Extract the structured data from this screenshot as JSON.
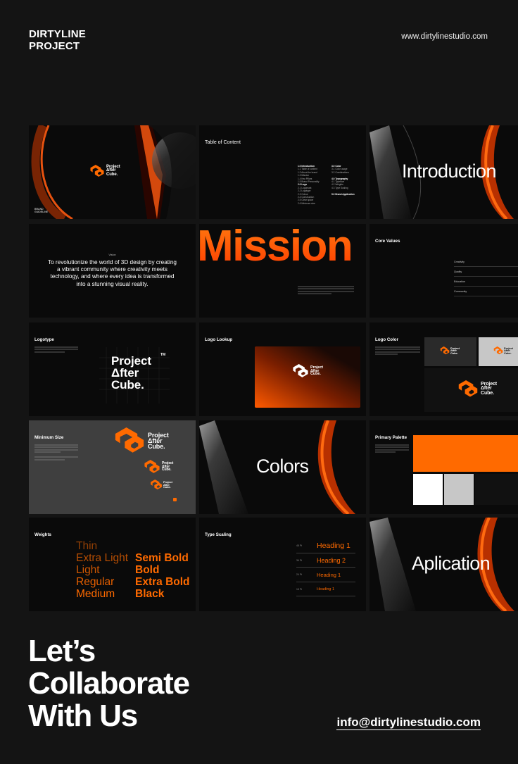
{
  "header": {
    "brand_line1": "DIRTYLINE",
    "brand_line2": "PROJECT",
    "website": "www.dirtylinestudio.com"
  },
  "logo": {
    "line1": "Project",
    "line2": "Δfter",
    "line3": "Cube.",
    "tm": "TM"
  },
  "slides": {
    "cover": {
      "caption_line1": "BRAND",
      "caption_line2": "GUIDELINE"
    },
    "toc": {
      "title": "Table of Content",
      "left": [
        "1.0   Introduction",
        "1.1   Table of content",
        "1.2   About the brand",
        "1.3   Mission",
        "1.4   Key Pillars",
        "1.5   Brand Personality",
        "2.0   Logo",
        "2.1   Logomark",
        "2.2   Logotype",
        "2.3   Colour",
        "2.4   Construction",
        "2.5   Clear space",
        "2.6   Minimum size"
      ],
      "right": [
        "3.0   Color",
        "3.1   Color usage",
        "3.2   Combinations",
        "",
        "4.0   Typography",
        "4.1   Typeface",
        "4.2   Weights",
        "4.3   Type Scaling",
        "",
        "5.0   Brand Application"
      ]
    },
    "introduction": {
      "title": "Introduction"
    },
    "vision": {
      "label": "Vision",
      "text": "To revolutionize the world of 3D design by creating a vibrant community where creativity meets technology, and where every idea is transformed into a stunning visual reality."
    },
    "mission": {
      "title": "Mission"
    },
    "core_values": {
      "title": "Core Values",
      "items": [
        "Creativity",
        "Quality",
        "Education",
        "Community"
      ]
    },
    "logotype": {
      "title": "Logotype"
    },
    "logo_lookup": {
      "title": "Logo Lookup"
    },
    "logo_color": {
      "title": "Logo Color"
    },
    "minimum_size": {
      "title": "Minimum Size"
    },
    "colors": {
      "title": "Colors"
    },
    "primary_palette": {
      "title": "Primary Palette"
    },
    "weights": {
      "title": "Weights",
      "left": [
        "Thin",
        "Extra Light",
        "Light",
        "Regular",
        "Medium"
      ],
      "right": [
        "Semi Bold",
        "Bold",
        "Extra Bold",
        "Black"
      ]
    },
    "type_scaling": {
      "title": "Type Scaling",
      "rows": [
        {
          "size": "48 Pt",
          "label": "Heading 1"
        },
        {
          "size": "36 Pt",
          "label": "Heading 2"
        },
        {
          "size": "24 Pt",
          "label": "Heading 1"
        },
        {
          "size": "18 Pt",
          "label": "Heading 1"
        }
      ]
    },
    "application": {
      "title": "Aplication"
    }
  },
  "footer": {
    "cta_line1": "Let’s",
    "cta_line2": "Collaborate",
    "cta_line3": "With Us",
    "email": "info@dirtylinestudio.com"
  },
  "colors": {
    "accent": "#ff6a00",
    "background": "#141414",
    "slide_bg": "#0a0a0a",
    "grey_slide": "#3f3f3f",
    "light_grey": "#c7c7c7"
  }
}
